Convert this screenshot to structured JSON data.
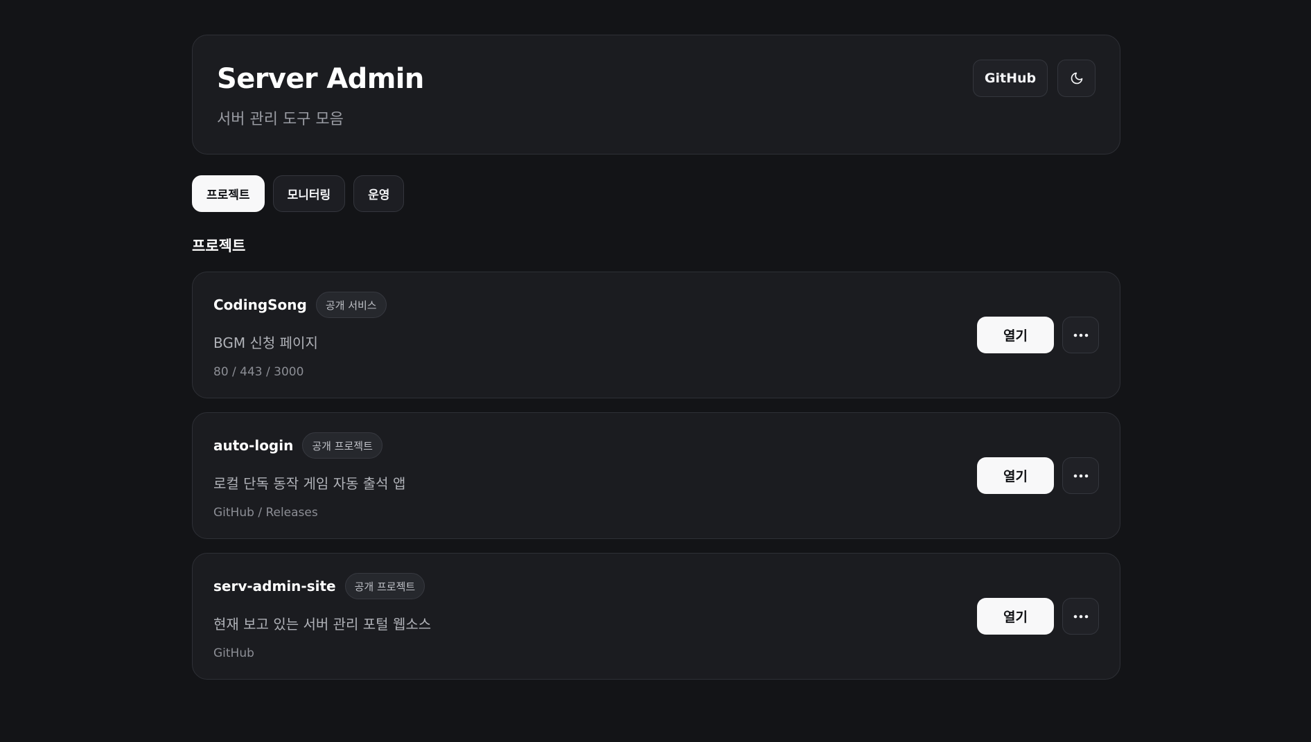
{
  "header": {
    "title": "Server Admin",
    "subtitle": "서버 관리 도구 모음",
    "github_label": "GitHub",
    "theme_icon": "moon-icon"
  },
  "tabs": [
    {
      "label": "프로젝트",
      "active": true
    },
    {
      "label": "모니터링",
      "active": false
    },
    {
      "label": "운영",
      "active": false
    }
  ],
  "section": {
    "title": "프로젝트"
  },
  "projects": [
    {
      "name": "CodingSong",
      "badge": "공개 서비스",
      "description": "BGM 신청 페이지",
      "meta": "80 / 443 / 3000",
      "open_label": "열기",
      "more_icon": "more-horizontal-icon"
    },
    {
      "name": "auto-login",
      "badge": "공개 프로젝트",
      "description": "로컬 단독 동작 게임 자동 출석 앱",
      "meta": "GitHub / Releases",
      "open_label": "열기",
      "more_icon": "more-horizontal-icon"
    },
    {
      "name": "serv-admin-site",
      "badge": "공개 프로젝트",
      "description": "현재 보고 있는 서버 관리 포털 웹소스",
      "meta": "GitHub",
      "open_label": "열기",
      "more_icon": "more-horizontal-icon"
    }
  ],
  "colors": {
    "background": "#131417",
    "card": "#1b1c20",
    "border": "#2e3036",
    "accent": "#f8f8f9"
  }
}
